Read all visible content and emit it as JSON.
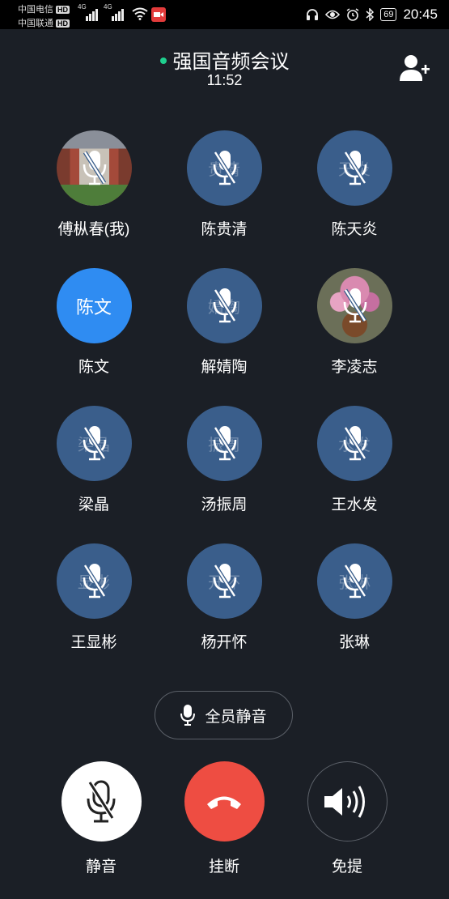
{
  "status_bar": {
    "carrier1": "中国电信",
    "carrier2": "中国联通",
    "hd": "HD",
    "network1": "4G",
    "network2": "4G",
    "battery": "69",
    "time": "20:45"
  },
  "header": {
    "title": "强国音频会议",
    "timer": "11:52",
    "live_color": "#1fd08f"
  },
  "members": [
    {
      "name": "傅枞春(我)",
      "avatar_text": "",
      "muted": true,
      "avatar": "photo-building"
    },
    {
      "name": "陈贵清",
      "avatar_text": "贵清",
      "muted": true
    },
    {
      "name": "陈天炎",
      "avatar_text": "天炎",
      "muted": true
    },
    {
      "name": "陈文",
      "avatar_text": "陈文",
      "muted": false,
      "active": true
    },
    {
      "name": "解婧陶",
      "avatar_text": "婧陶",
      "muted": true
    },
    {
      "name": "李凌志",
      "avatar_text": "",
      "muted": true,
      "avatar": "photo-flowers"
    },
    {
      "name": "梁晶",
      "avatar_text": "梁晶",
      "muted": true
    },
    {
      "name": "汤振周",
      "avatar_text": "振周",
      "muted": true
    },
    {
      "name": "王水发",
      "avatar_text": "水发",
      "muted": true
    },
    {
      "name": "王显彬",
      "avatar_text": "显彬",
      "muted": true
    },
    {
      "name": "杨开怀",
      "avatar_text": "开怀",
      "muted": true
    },
    {
      "name": "张琳",
      "avatar_text": "张琳",
      "muted": true
    }
  ],
  "mute_all_label": "全员静音",
  "controls": {
    "mute_label": "静音",
    "hangup_label": "挂断",
    "speaker_label": "免提"
  },
  "colors": {
    "background": "#1b1f26",
    "avatar_bg": "#3a5e8b",
    "active_avatar": "#2f8cf2",
    "hangup": "#ee4d42"
  }
}
